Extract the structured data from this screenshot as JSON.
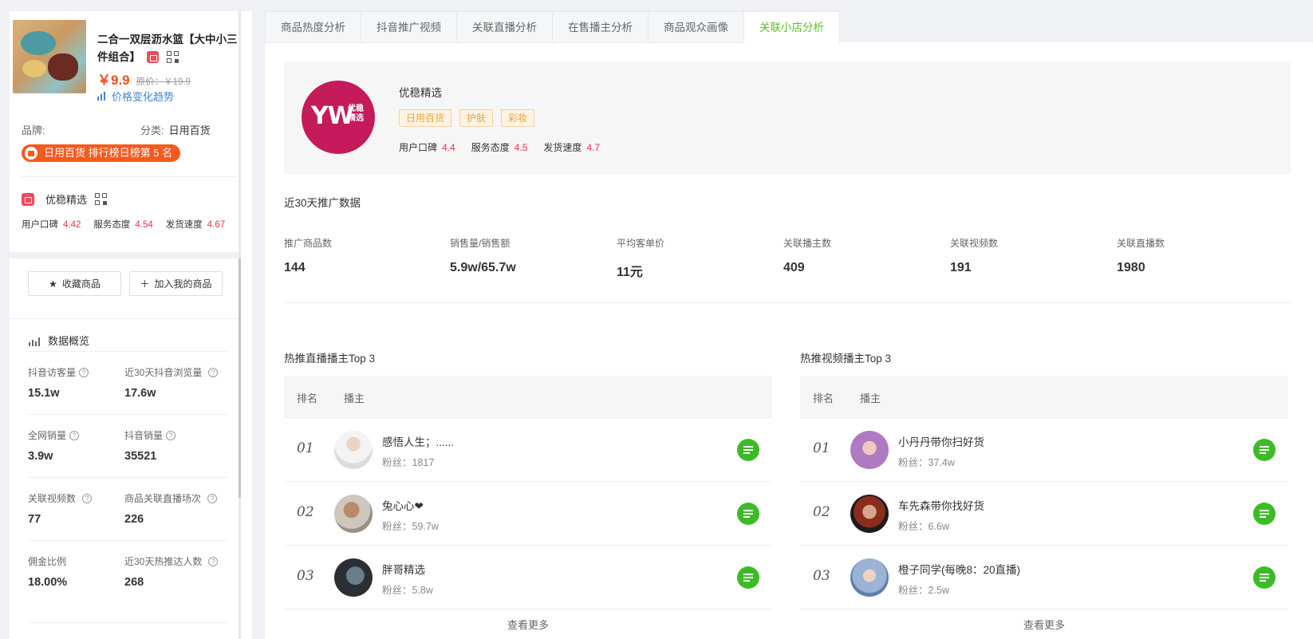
{
  "product": {
    "title": "二合一双层沥水篮【大中小三件组合】",
    "price": "￥9.9",
    "original_price": "原价：￥19.9",
    "trend_link": "价格变化趋势",
    "brand_label": "品牌:",
    "category_label": "分类:",
    "category_value": "日用百货",
    "rank_badge": "日用百货 排行榜日榜第 5 名"
  },
  "sidebar_shop": {
    "name": "优稳精选",
    "scores": [
      {
        "label": "用户口碑",
        "value": "4.42"
      },
      {
        "label": "服务态度",
        "value": "4.54"
      },
      {
        "label": "发货速度",
        "value": "4.67"
      }
    ]
  },
  "actions": {
    "favorite_label": "收藏商品",
    "add_label": "加入我的商品"
  },
  "overview": {
    "title": "数据概览",
    "stats": [
      {
        "label": "抖音访客量",
        "value": "15.1w"
      },
      {
        "label": "近30天抖音浏览量",
        "value": "17.6w"
      },
      {
        "label": "全网销量",
        "value": "3.9w"
      },
      {
        "label": "抖音销量",
        "value": "35521"
      },
      {
        "label": "关联视频数",
        "value": "77"
      },
      {
        "label": "商品关联直播场次",
        "value": "226"
      },
      {
        "label": "佣金比例",
        "value": "18.00%"
      },
      {
        "label": "近30天热推达人数",
        "value": "268"
      }
    ]
  },
  "tabs": [
    "商品热度分析",
    "抖音推广视频",
    "关联直播分析",
    "在售播主分析",
    "商品观众画像",
    "关联小店分析"
  ],
  "active_tab": "关联小店分析",
  "shop": {
    "logo_text": "YW",
    "logo_sub": "优稳精选",
    "name": "优稳精选",
    "tags": [
      "日用百货",
      "护肤",
      "彩妆"
    ],
    "scores": [
      {
        "label": "用户口碑",
        "value": "4.4"
      },
      {
        "label": "服务态度",
        "value": "4.5"
      },
      {
        "label": "发货速度",
        "value": "4.7"
      }
    ]
  },
  "promo": {
    "title": "近30天推广数据",
    "metrics": [
      {
        "label": "推广商品数",
        "value": "144"
      },
      {
        "label": "销售量/销售额",
        "value": "5.9w/65.7w"
      },
      {
        "label": "平均客单价",
        "value": "11元"
      },
      {
        "label": "关联播主数",
        "value": "409"
      },
      {
        "label": "关联视频数",
        "value": "191"
      },
      {
        "label": "关联直播数",
        "value": "1980"
      }
    ]
  },
  "live_top": {
    "title": "热推直播播主Top 3",
    "col_rank": "排名",
    "col_host": "播主",
    "rows": [
      {
        "rank": "01",
        "name": "感悟人生；......",
        "fans": "粉丝：1817"
      },
      {
        "rank": "02",
        "name": "兔心心❤",
        "fans": "粉丝：59.7w"
      },
      {
        "rank": "03",
        "name": "胖哥精选",
        "fans": "粉丝：5.8w"
      }
    ],
    "more": "查看更多"
  },
  "video_top": {
    "title": "热推视频播主Top 3",
    "col_rank": "排名",
    "col_host": "播主",
    "rows": [
      {
        "rank": "01",
        "name": "小丹丹带你扫好货",
        "fans": "粉丝：37.4w"
      },
      {
        "rank": "02",
        "name": "车先森带你找好货",
        "fans": "粉丝：6.6w"
      },
      {
        "rank": "03",
        "name": "橙子同学(每晚8：20直播)",
        "fans": "粉丝：2.5w"
      }
    ],
    "more": "查看更多"
  },
  "colors": {
    "accent_green": "#5cbf2a",
    "price_orange": "#f54c1c",
    "score_red": "#f0314b",
    "shop_logo": "#c51b5b"
  }
}
